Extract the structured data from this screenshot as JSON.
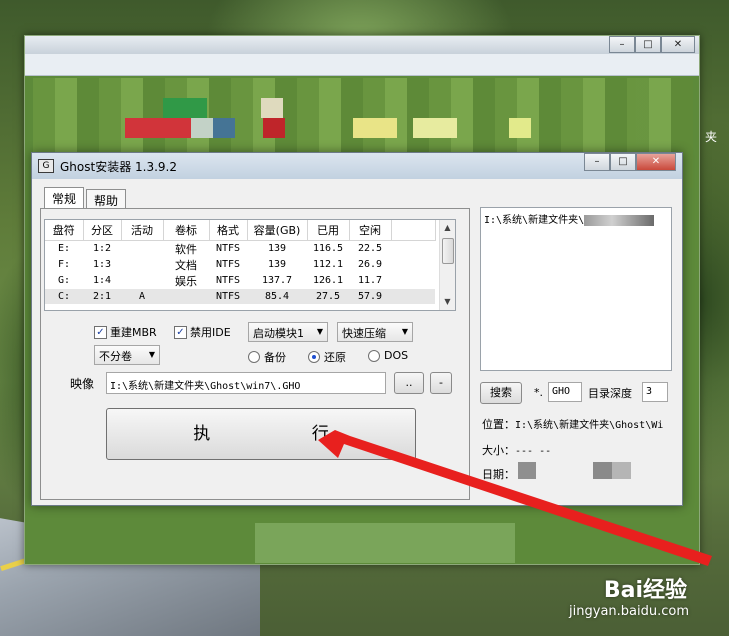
{
  "app": {
    "title": "Ghost安装器 1.3.9.2",
    "tabs": [
      {
        "label": "常规"
      },
      {
        "label": "帮助"
      }
    ]
  },
  "partition_table": {
    "columns": [
      "盘符",
      "分区",
      "活动",
      "卷标",
      "格式",
      "容量(GB)",
      "已用",
      "空闲"
    ],
    "rows": [
      {
        "drive": "E:",
        "part": "1:2",
        "active": "",
        "label": "软件",
        "fs": "NTFS",
        "size": "139",
        "used": "116.5",
        "free": "22.5"
      },
      {
        "drive": "F:",
        "part": "1:3",
        "active": "",
        "label": "文档",
        "fs": "NTFS",
        "size": "139",
        "used": "112.1",
        "free": "26.9"
      },
      {
        "drive": "G:",
        "part": "1:4",
        "active": "",
        "label": "娱乐",
        "fs": "NTFS",
        "size": "137.7",
        "used": "126.1",
        "free": "11.7"
      },
      {
        "drive": "C:",
        "part": "2:1",
        "active": "A",
        "label": "",
        "fs": "NTFS",
        "size": "85.4",
        "used": "27.5",
        "free": "57.9"
      }
    ]
  },
  "options": {
    "rebuild_mbr": "重建MBR",
    "disable_ide": "禁用IDE",
    "boot_module": "启动模块1",
    "compression": "快速压缩",
    "split": "不分卷",
    "radio_backup": "备份",
    "radio_restore": "还原",
    "radio_dos": "DOS"
  },
  "image": {
    "label": "映像",
    "path": "I:\\系统\\新建文件夹\\Ghost\\win7\\.GHO",
    "browse_label": "..",
    "minus_label": "-"
  },
  "execute_label": "执 行",
  "right_panel": {
    "list_item": "I:\\系统\\新建文件夹\\",
    "search_label": "搜索",
    "ext_prefix": "*.",
    "ext_value": "GHO",
    "depth_label": "目录深度",
    "depth_value": "3",
    "location_label": "位置：",
    "location_value": "I:\\系统\\新建文件夹\\Ghost\\Wi",
    "size_label": "大小：",
    "size_value": "--- --",
    "date_label": "日期："
  },
  "desktop": {
    "watermark": "Bai经验",
    "watermark_sub": "jingyan.baidu.com",
    "edge_text": "夹"
  },
  "colors": {
    "arrow": "#e8201e",
    "titlebar": "#c8d6e4"
  }
}
